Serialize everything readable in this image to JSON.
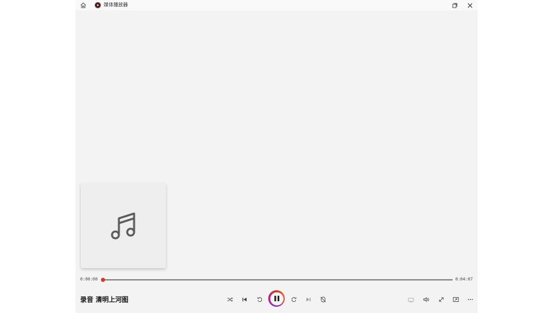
{
  "app": {
    "title": "媒体播放器",
    "accent_color": "#d13a2a",
    "secondary_accent": "#7b2fb5"
  },
  "titlebar": {
    "home_icon": "home-icon",
    "logo_icon": "media-player-logo-icon",
    "buttons": [
      "restore-icon",
      "close-icon"
    ]
  },
  "album_art": {
    "icon": "music-note-icon"
  },
  "playback": {
    "current_time": "0:00:00",
    "total_time": "0:04:07",
    "progress": 0.0
  },
  "now_playing": {
    "title": "录音 清明上河图"
  },
  "controls": {
    "left_group": [
      "shuffle-icon",
      "previous-icon",
      "rewind-10-icon",
      "pause-icon",
      "forward-30-icon",
      "next-icon",
      "repeat-off-icon"
    ],
    "right_group": [
      "cast-icon",
      "volume-icon",
      "fullscreen-icon",
      "mini-player-icon",
      "more-icon"
    ]
  }
}
